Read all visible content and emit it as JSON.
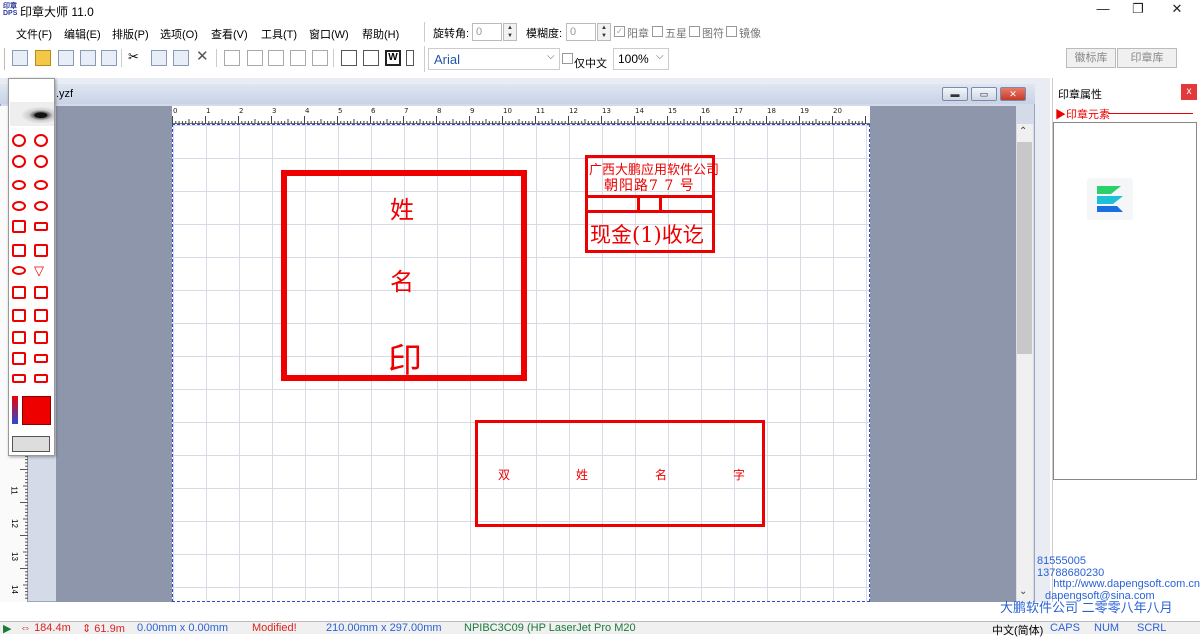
{
  "window": {
    "title": "印章大师 11.0",
    "controls": [
      "—",
      "❐",
      "✕"
    ]
  },
  "menu": [
    "文件(F)",
    "编辑(E)",
    "排版(P)",
    "选项(O)",
    "查看(V)",
    "工具(T)",
    "窗口(W)",
    "帮助(H)"
  ],
  "stamp_options": {
    "rotation_label": "旋转角:",
    "rotation_value": "0",
    "blur_label": "模糊度:",
    "blur_value": "0",
    "yang_label": "阳章",
    "star_label": "五星",
    "pattern_label": "图符",
    "mirror_label": "镜像"
  },
  "format": {
    "font": "Arial",
    "chinese_only_label": "仅中文",
    "zoom": "100%"
  },
  "tabs": [
    "徽标库",
    "印章库"
  ],
  "document": {
    "title_suffix": ".yzf",
    "ruler_numbers": [
      "0",
      "1",
      "2",
      "3",
      "4",
      "5",
      "6",
      "7",
      "8",
      "9",
      "10",
      "11",
      "12",
      "13",
      "14",
      "15",
      "16",
      "17",
      "18",
      "19",
      "20"
    ],
    "left_ruler_numbers": [
      "11",
      "12",
      "13",
      "14"
    ]
  },
  "stamps": {
    "name_chars": [
      "姓",
      "名",
      "印"
    ],
    "company_line1": "广西大鹏应用软件公司",
    "company_line2": "朝阳路7 7 号",
    "receipt_text": "现金(1)收讫",
    "double_name_chars": [
      "双",
      "姓",
      "名",
      "字"
    ]
  },
  "right_panel": {
    "title": "印章属性",
    "close": "x",
    "section": "▶印章元素"
  },
  "contact": {
    "phone1": "81555005",
    "phone2": "13788680230",
    "website": "http://www.dapengsoft.com.cn",
    "email": "dapengsoft@sina.com",
    "company": "大鹏软件公司 二零零八年八月"
  },
  "status": {
    "x": "184.4m",
    "y": "61.9m",
    "size": "0.00mm x 0.00mm",
    "modified": "Modified!",
    "page_size": "210.00mm x 297.00mm",
    "printer": "NPIBC3C09 (HP LaserJet Pro M20",
    "ime": "中文(简体)",
    "caps": "CAPS",
    "num": "NUM",
    "scrl": "SCRL"
  },
  "colors": {
    "stamp_red": "#e00000",
    "accent_blue": "#2a62d6"
  }
}
